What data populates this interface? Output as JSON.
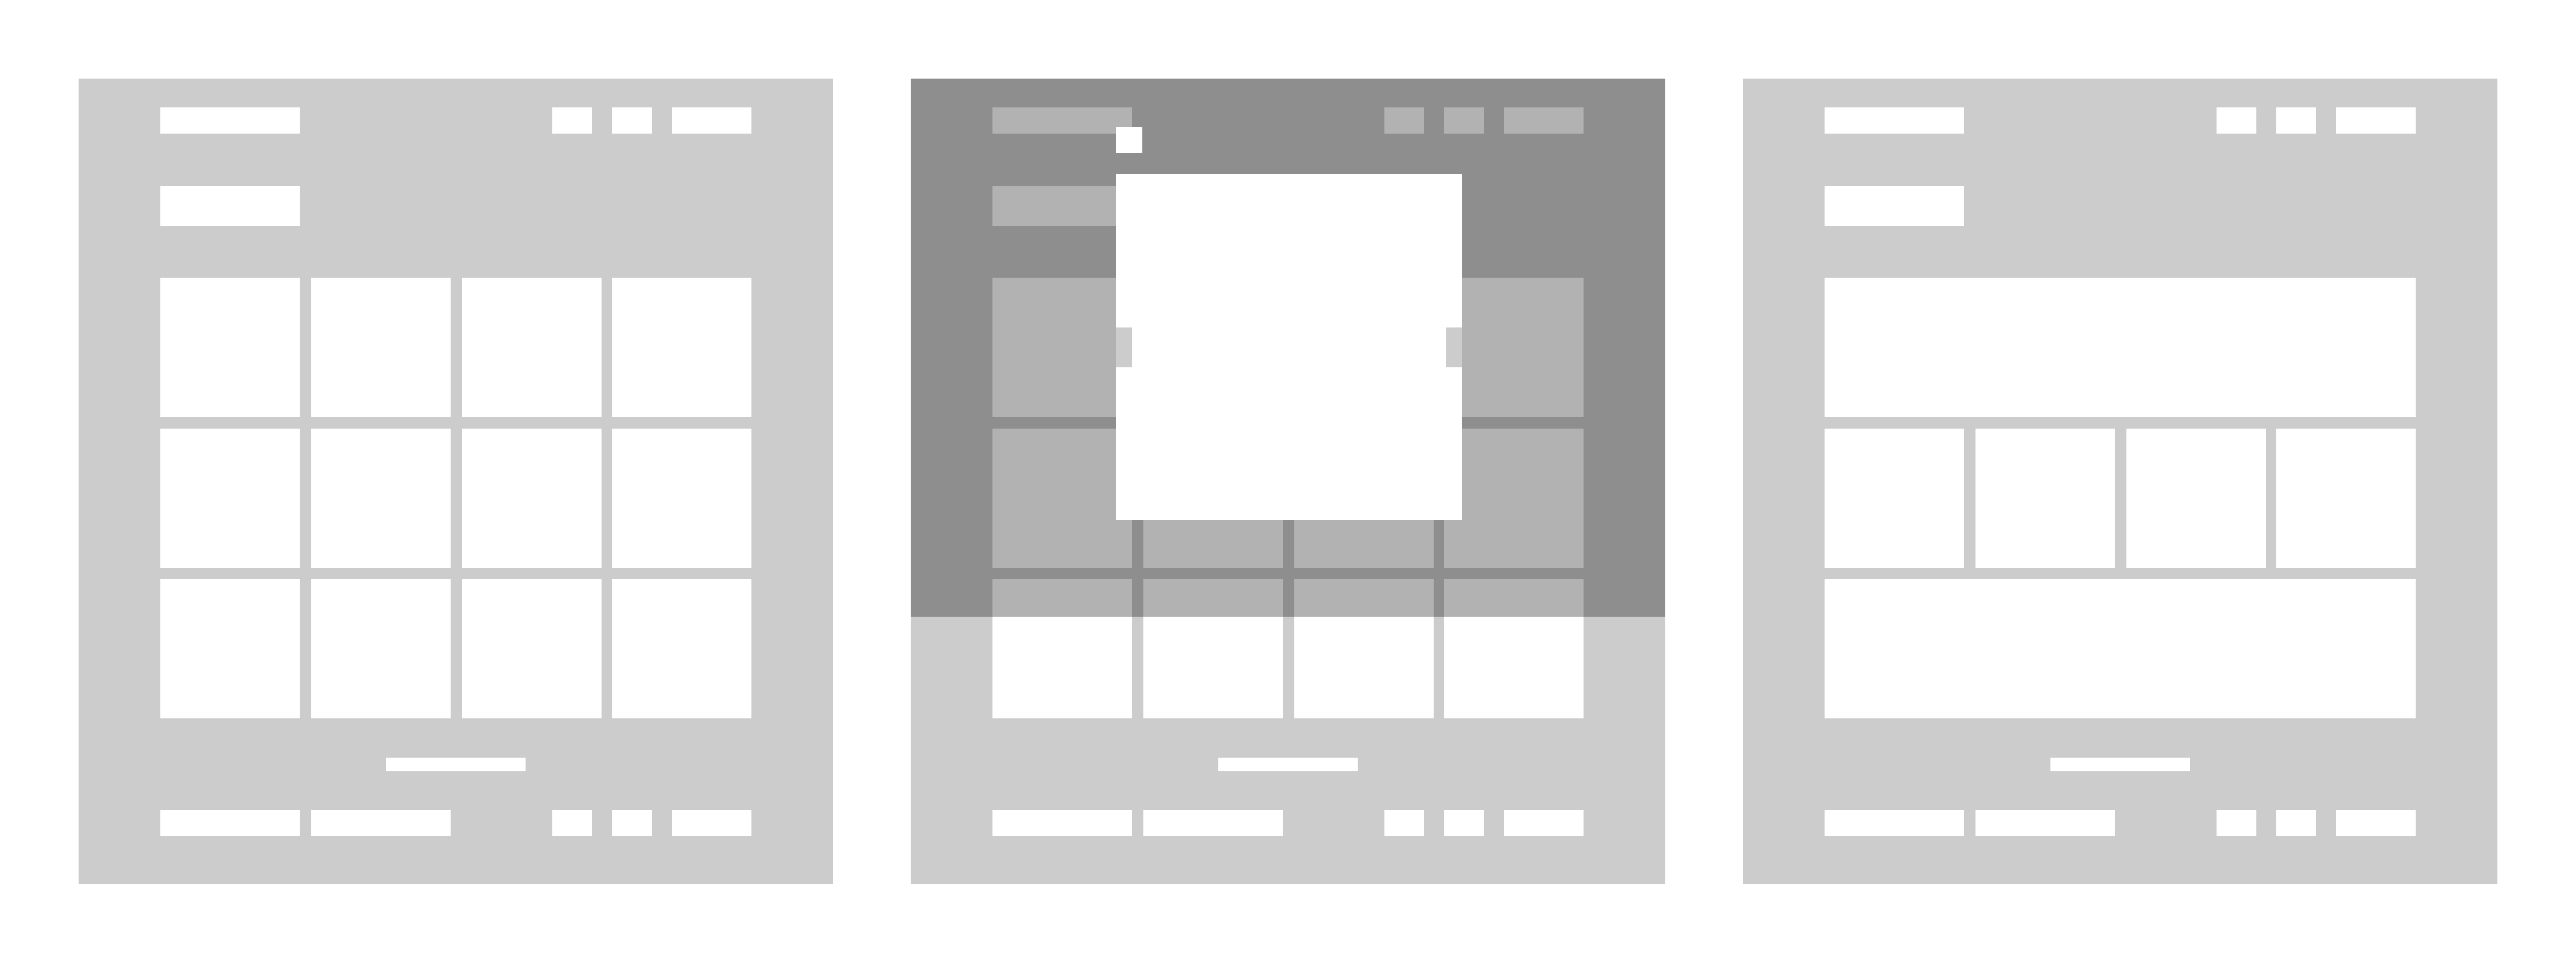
{
  "colors": {
    "page_background": "#ffffff",
    "panel_background": "#cccccc",
    "block": "#ffffff",
    "overlay": "rgba(0,0,0,0.30)"
  },
  "panels": [
    {
      "variant": "grid-4x3"
    },
    {
      "variant": "grid-4x3-with-modal-open"
    },
    {
      "variant": "banner-row-of-four-banner"
    }
  ]
}
